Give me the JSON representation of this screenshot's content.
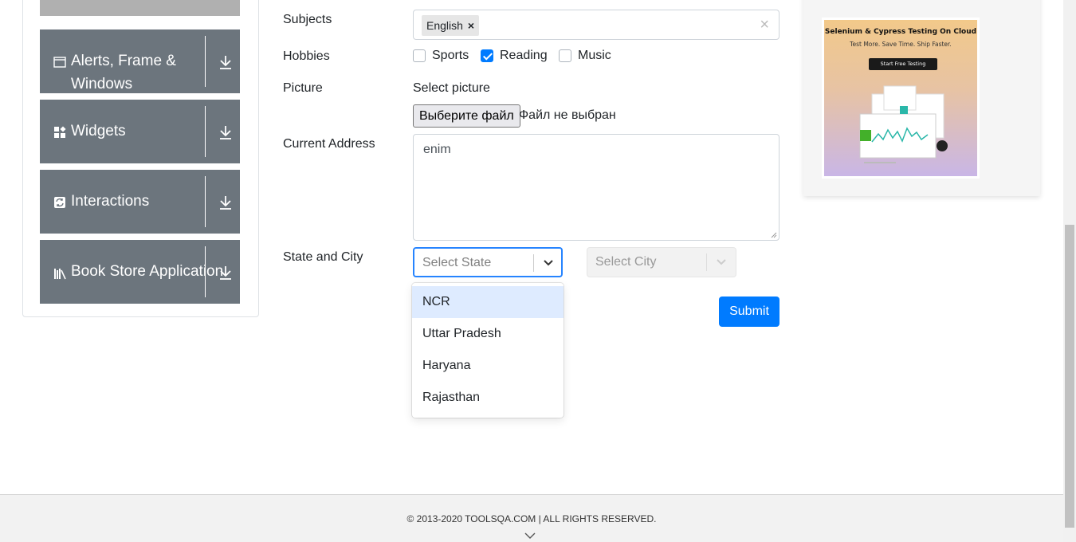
{
  "sidebar": {
    "groups": [
      {
        "label": "Alerts, Frame & Windows",
        "icon": "window-icon"
      },
      {
        "label": "Widgets",
        "icon": "widgets-icon"
      },
      {
        "label": "Interactions",
        "icon": "interactions-icon"
      },
      {
        "label": "Book Store Application",
        "icon": "books-icon"
      }
    ]
  },
  "form": {
    "subjects_label": "Subjects",
    "subjects_chip": "English",
    "subjects_chip_remove": "×",
    "subjects_clear": "×",
    "hobbies_label": "Hobbies",
    "hobbies": [
      {
        "label": "Sports",
        "checked": false
      },
      {
        "label": "Reading",
        "checked": true
      },
      {
        "label": "Music",
        "checked": false
      }
    ],
    "picture_label": "Picture",
    "select_picture": "Select picture",
    "file_button": "Выберите файл",
    "file_status": "Файл не выбран",
    "address_label": "Current Address",
    "address_value": "enim",
    "state_city_label": "State and City",
    "state_placeholder": "Select State",
    "city_placeholder": "Select City",
    "state_options": [
      "NCR",
      "Uttar Pradesh",
      "Haryana",
      "Rajasthan"
    ],
    "submit_label": "Submit"
  },
  "ad": {
    "title": "Selenium & Cypress Testing On Cloud",
    "subtitle": "Test More. Save Time. Ship Faster.",
    "button": "Start Free Testing"
  },
  "footer": {
    "text": "© 2013-2020 TOOLSQA.COM | ALL RIGHTS RESERVED."
  },
  "colors": {
    "accent": "#007bff",
    "sidebar_group": "#6c757d",
    "focus_border": "#2684ff",
    "option_focus": "#deebff"
  }
}
